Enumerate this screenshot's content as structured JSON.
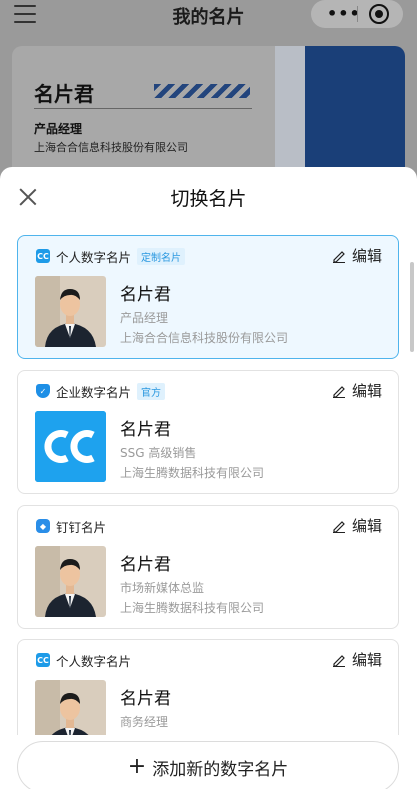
{
  "background": {
    "title": "我的名片",
    "card": {
      "name": "名片君",
      "title": "产品经理",
      "company": "上海合合信息科技股份有限公司"
    }
  },
  "sheet": {
    "title": "切换名片",
    "edit_label": "编辑",
    "add_button_label": "添加新的数字名片",
    "cards": [
      {
        "type": "个人数字名片",
        "badge": "定制名片",
        "name": "名片君",
        "title": "产品经理",
        "company": "上海合合信息科技股份有限公司",
        "icon": "cc-icon"
      },
      {
        "type": "企业数字名片",
        "badge": "官方",
        "name": "名片君",
        "title": "SSG 高级销售",
        "company": "上海生腾数据科技有限公司",
        "icon": "shield-icon"
      },
      {
        "type": "钉钉名片",
        "badge": "",
        "name": "名片君",
        "title": "市场新媒体总监",
        "company": "上海生腾数据科技有限公司",
        "icon": "dingtalk-icon"
      },
      {
        "type": "个人数字名片",
        "badge": "",
        "name": "名片君",
        "title": "商务经理",
        "company": "",
        "icon": "cc-icon"
      }
    ]
  },
  "colors": {
    "accent": "#1e9be8",
    "selected_border": "#4fb4ec",
    "selected_bg": "#eef8ff"
  }
}
